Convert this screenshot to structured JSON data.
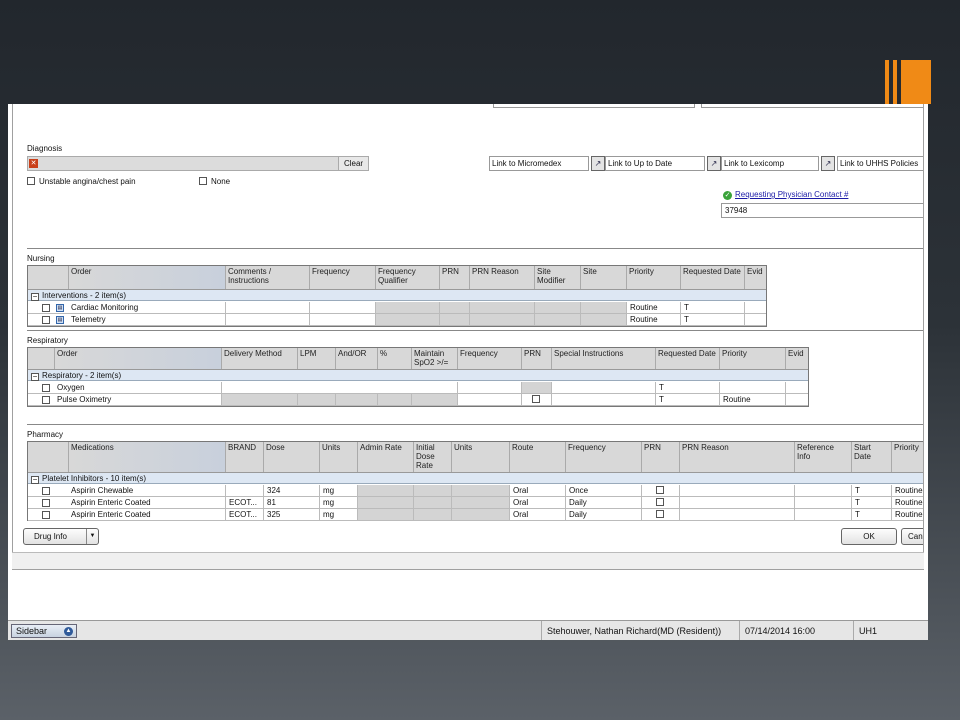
{
  "diagnosis": {
    "label": "Diagnosis",
    "clear_label": "Clear",
    "options": [
      "Unstable angina/chest pain",
      "None"
    ]
  },
  "links": [
    {
      "label": "Link to Micromedex"
    },
    {
      "label": "Link to Up to Date"
    },
    {
      "label": "Link to Lexicomp"
    },
    {
      "label": "Link to UHHS Policies"
    }
  ],
  "contact": {
    "label": "Requesting Physician Contact #",
    "value": "37948"
  },
  "nursing": {
    "section_label": "Nursing",
    "headers": [
      "Order",
      "Comments / Instructions",
      "Frequency",
      "Frequency Qualifier",
      "PRN",
      "PRN Reason",
      "Site Modifier",
      "Site",
      "Priority",
      "Requested Date",
      "Evid"
    ],
    "group": "Interventions - 2 item(s)",
    "rows": [
      {
        "order": "Cardiac Monitoring",
        "priority": "Routine",
        "date": "T"
      },
      {
        "order": "Telemetry",
        "priority": "Routine",
        "date": "T"
      }
    ]
  },
  "respiratory": {
    "section_label": "Respiratory",
    "headers": [
      "Order",
      "Delivery Method",
      "LPM",
      "And/OR",
      "%",
      "Maintain SpO2 >/=",
      "Frequency",
      "PRN",
      "Special Instructions",
      "Requested Date",
      "Priority",
      "Evid"
    ],
    "group": "Respiratory - 2 item(s)",
    "rows": [
      {
        "order": "Oxygen",
        "date": "T",
        "priority": ""
      },
      {
        "order": "Pulse Oximetry",
        "date": "T",
        "priority": "Routine"
      }
    ]
  },
  "pharmacy": {
    "section_label": "Pharmacy",
    "headers": [
      "Medications",
      "BRAND",
      "Dose",
      "Units",
      "Admin Rate",
      "Initial Dose Rate",
      "Units",
      "Route",
      "Frequency",
      "PRN",
      "PRN Reason",
      "Reference Info",
      "Start Date",
      "Priority"
    ],
    "group": "Platelet Inhibitors - 10 item(s)",
    "rows": [
      {
        "med": "Aspirin Chewable",
        "brand": "",
        "dose": "324",
        "units": "mg",
        "route": "Oral",
        "freq": "Once",
        "start": "T",
        "priority": "Routine"
      },
      {
        "med": "Aspirin Enteric Coated",
        "brand": "ECOT...",
        "dose": "81",
        "units": "mg",
        "route": "Oral",
        "freq": "Daily",
        "start": "T",
        "priority": "Routine"
      },
      {
        "med": "Aspirin Enteric Coated",
        "brand": "ECOT...",
        "dose": "325",
        "units": "mg",
        "route": "Oral",
        "freq": "Daily",
        "start": "T",
        "priority": "Routine"
      }
    ]
  },
  "buttons": {
    "drug_info": "Drug Info",
    "ok": "OK",
    "cancel": "Can"
  },
  "status": {
    "sidebar": "Sidebar",
    "user": "Stehouwer, Nathan Richard(MD (Resident))",
    "datetime": "07/14/2014 16:00",
    "location": "UH1"
  },
  "colors": {
    "accent": "#f08a16",
    "group_row": "#dde7f3",
    "header": "#d8d8d8"
  }
}
